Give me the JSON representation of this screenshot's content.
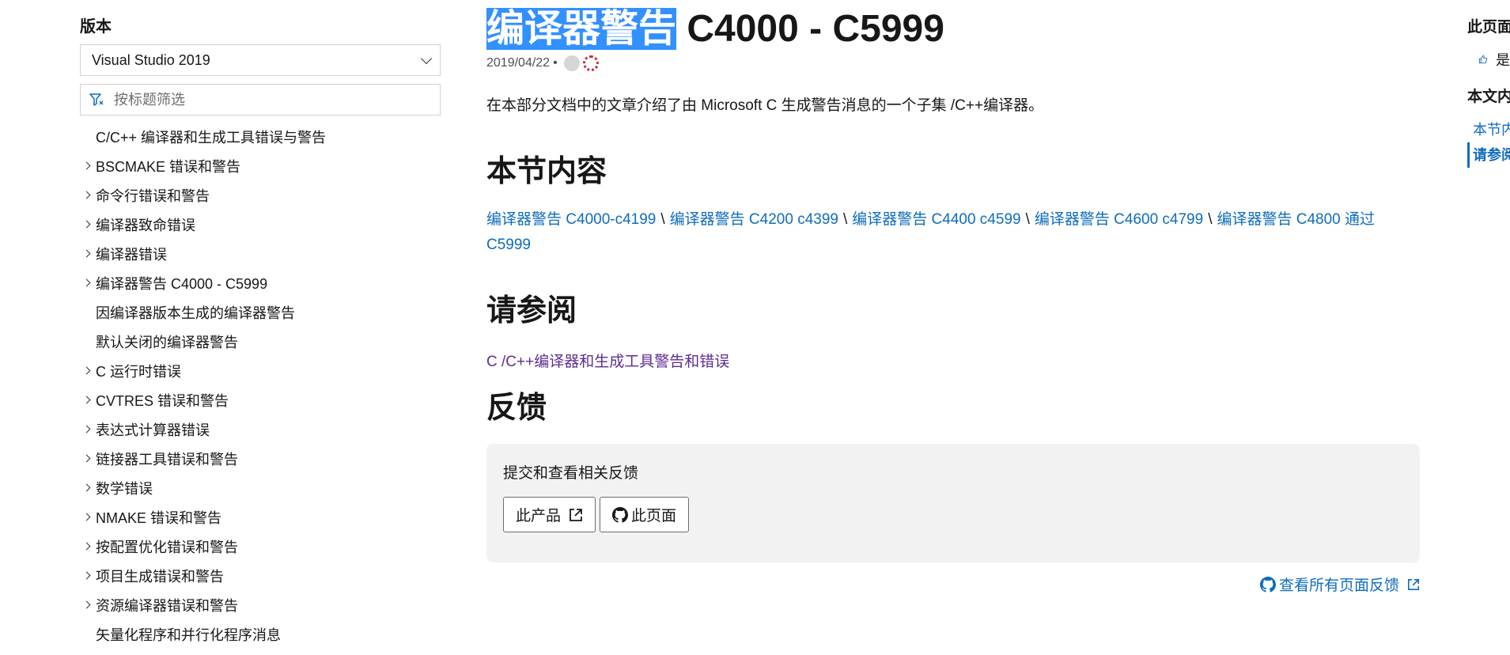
{
  "left_nav": {
    "version_label": "版本",
    "version_selected": "Visual Studio 2019",
    "filter_placeholder": "按标题筛选",
    "toc": [
      {
        "label": "C/C++ 编译器和生成工具错误与警告",
        "expandable": false
      },
      {
        "label": "BSCMAKE 错误和警告",
        "expandable": true
      },
      {
        "label": "命令行错误和警告",
        "expandable": true
      },
      {
        "label": "编译器致命错误",
        "expandable": true
      },
      {
        "label": "编译器错误",
        "expandable": true
      },
      {
        "label": "编译器警告 C4000 - C5999",
        "expandable": true
      },
      {
        "label": "因编译器版本生成的编译器警告",
        "expandable": false
      },
      {
        "label": "默认关闭的编译器警告",
        "expandable": false
      },
      {
        "label": "C 运行时错误",
        "expandable": true
      },
      {
        "label": "CVTRES 错误和警告",
        "expandable": true
      },
      {
        "label": "表达式计算器错误",
        "expandable": true
      },
      {
        "label": "链接器工具错误和警告",
        "expandable": true
      },
      {
        "label": "数学错误",
        "expandable": true
      },
      {
        "label": "NMAKE 错误和警告",
        "expandable": true
      },
      {
        "label": "按配置优化错误和警告",
        "expandable": true
      },
      {
        "label": "项目生成错误和警告",
        "expandable": true
      },
      {
        "label": "资源编译器错误和警告",
        "expandable": true
      },
      {
        "label": "矢量化程序和并行化程序消息",
        "expandable": false
      }
    ]
  },
  "main": {
    "title_highlighted": "编译器警告",
    "title_rest": " C4000 - C5999",
    "date": "2019/04/22",
    "date_separator": "•",
    "intro": "在本部分文档中的文章介绍了由 Microsoft C 生成警告消息的一个子集 /C++编译器。",
    "section_contents_heading": "本节内容",
    "section_links": [
      "编译器警告 C4000-c4199",
      "编译器警告 C4200 c4399",
      "编译器警告 C4400 c4599",
      "编译器警告 C4600 c4799",
      "编译器警告 C4800 通过 C5999"
    ],
    "link_separator": "\\",
    "see_also_heading": "请参阅",
    "see_also_link": "C /C++编译器和生成工具警告和错误",
    "feedback_heading": "反馈",
    "feedback_text": "提交和查看相关反馈",
    "feedback_product_button": "此产品",
    "feedback_page_button": "此页面",
    "view_all_feedback": "查看所有页面反馈"
  },
  "right_rail": {
    "heading_page": "此页面",
    "helpful_yes": "是",
    "heading_toc": "本文内容",
    "toc": [
      {
        "label": "本节内容",
        "active": false
      },
      {
        "label": "请参阅",
        "active": true
      }
    ]
  },
  "colors": {
    "link": "#0f6cbd",
    "visited_link": "#5c2e91",
    "selection_highlight": "#3390ff",
    "feedback_bg": "#f2f2f2"
  },
  "icons": [
    "chevron-down-icon",
    "filter-icon",
    "chevron-right-icon",
    "external-link-icon",
    "github-icon",
    "thumbs-up-icon"
  ]
}
